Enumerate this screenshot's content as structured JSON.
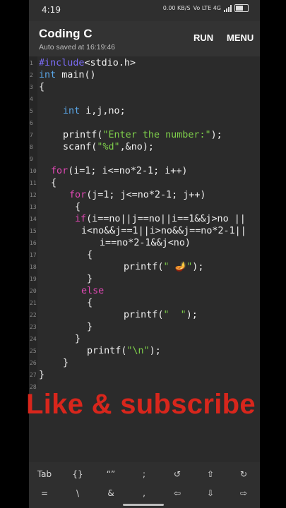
{
  "status_bar": {
    "time": "4:19",
    "net_speed": "0.00 KB/S",
    "network": "Vo LTE 4G"
  },
  "app_bar": {
    "title": "Coding C",
    "subtitle": "Auto saved at 16:19:46",
    "run_label": "RUN",
    "menu_label": "MENU"
  },
  "editor": {
    "line_numbers": [
      "1",
      "2",
      "3",
      "4",
      "5",
      "6",
      "7",
      "8",
      "9",
      "10",
      "11",
      "12",
      "13",
      "14",
      "15",
      "16",
      "17",
      "18",
      "19",
      "20",
      "21",
      "22",
      "23",
      "24",
      "25",
      "26",
      "27",
      "28"
    ],
    "lines": {
      "l1_pp": "#include",
      "l1_rest": "<stdio.h>",
      "l2_type": "int",
      "l2_rest": " main()",
      "l3": "{",
      "l5_type": "int",
      "l5_rest": " i,j,no;",
      "l7_a": "printf(",
      "l7_str": "\"Enter the number:\"",
      "l7_b": ");",
      "l8_a": "scanf(",
      "l8_str": "\"%d\"",
      "l8_b": ",&no);",
      "l10_kw": "for",
      "l10_rest": "(i=1; i<=no*2-1; i++)",
      "l11": "{",
      "l12_kw": "for",
      "l12_rest": "(j=1; j<=no*2-1; j++)",
      "l13": "{",
      "l14_kw": "if",
      "l14_rest": "(i==no||j==no||i==1&&j>no ||",
      "l15": "i<no&&j==1||i>no&&j==no*2-1||",
      "l16": "i==no*2-1&&j<no)",
      "l17": "{",
      "l18_a": "printf(",
      "l18_str": "\" 🪔\"",
      "l18_b": ");",
      "l19": "}",
      "l20_kw": "else",
      "l21": "{",
      "l22_a": "printf(",
      "l22_str": "\"  \"",
      "l22_b": ");",
      "l23": "}",
      "l24": "}",
      "l25_a": "printf(",
      "l25_str": "\"\\n\"",
      "l25_b": ");",
      "l26": "}",
      "l27": "}"
    }
  },
  "overlay_text": "Like & subscribe",
  "keyboard": {
    "row1": [
      "Tab",
      "{}",
      "“”",
      ";",
      "↺",
      "⇧",
      "↻"
    ],
    "row2": [
      "=",
      "\\",
      "&",
      ",",
      "⇦",
      "⇩",
      "⇨"
    ]
  }
}
